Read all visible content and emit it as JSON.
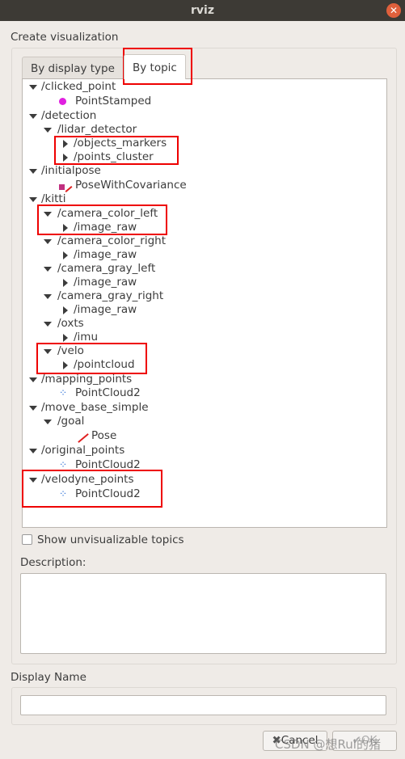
{
  "window": {
    "title": "rviz"
  },
  "heading": "Create visualization",
  "tabs": [
    {
      "label": "By display type",
      "active": false
    },
    {
      "label": "By topic",
      "active": true
    }
  ],
  "tree": [
    {
      "level": 0,
      "kind": "topic",
      "label": "/clicked_point",
      "expanded": true
    },
    {
      "level": 1,
      "kind": "type",
      "label": "PointStamped",
      "icon": "point-stamped-icon"
    },
    {
      "level": 0,
      "kind": "topic",
      "label": "/detection",
      "expanded": true
    },
    {
      "level": 1,
      "kind": "topic",
      "label": "/lidar_detector",
      "expanded": true
    },
    {
      "level": 2,
      "kind": "topic",
      "label": "/objects_markers",
      "expanded": false
    },
    {
      "level": 2,
      "kind": "topic",
      "label": "/points_cluster",
      "expanded": false
    },
    {
      "level": 0,
      "kind": "topic",
      "label": "/initialpose",
      "expanded": true
    },
    {
      "level": 1,
      "kind": "type",
      "label": "PoseWithCovariance",
      "icon": "pose-with-covariance-icon"
    },
    {
      "level": 0,
      "kind": "topic",
      "label": "/kitti",
      "expanded": true
    },
    {
      "level": 1,
      "kind": "topic",
      "label": "/camera_color_left",
      "expanded": true
    },
    {
      "level": 2,
      "kind": "topic",
      "label": "/image_raw",
      "expanded": false
    },
    {
      "level": 1,
      "kind": "topic",
      "label": "/camera_color_right",
      "expanded": true
    },
    {
      "level": 2,
      "kind": "topic",
      "label": "/image_raw",
      "expanded": false
    },
    {
      "level": 1,
      "kind": "topic",
      "label": "/camera_gray_left",
      "expanded": true
    },
    {
      "level": 2,
      "kind": "topic",
      "label": "/image_raw",
      "expanded": false
    },
    {
      "level": 1,
      "kind": "topic",
      "label": "/camera_gray_right",
      "expanded": true
    },
    {
      "level": 2,
      "kind": "topic",
      "label": "/image_raw",
      "expanded": false
    },
    {
      "level": 1,
      "kind": "topic",
      "label": "/oxts",
      "expanded": true
    },
    {
      "level": 2,
      "kind": "topic",
      "label": "/imu",
      "expanded": false
    },
    {
      "level": 1,
      "kind": "topic",
      "label": "/velo",
      "expanded": true
    },
    {
      "level": 2,
      "kind": "topic",
      "label": "/pointcloud",
      "expanded": false
    },
    {
      "level": 0,
      "kind": "topic",
      "label": "/mapping_points",
      "expanded": true
    },
    {
      "level": 1,
      "kind": "type",
      "label": "PointCloud2",
      "icon": "pointcloud-icon"
    },
    {
      "level": 0,
      "kind": "topic",
      "label": "/move_base_simple",
      "expanded": true
    },
    {
      "level": 1,
      "kind": "topic",
      "label": "/goal",
      "expanded": true
    },
    {
      "level": 2,
      "kind": "type",
      "label": "Pose",
      "icon": "pose-icon"
    },
    {
      "level": 0,
      "kind": "topic",
      "label": "/original_points",
      "expanded": true
    },
    {
      "level": 1,
      "kind": "type",
      "label": "PointCloud2",
      "icon": "pointcloud-icon"
    },
    {
      "level": 0,
      "kind": "topic",
      "label": "/velodyne_points",
      "expanded": true
    },
    {
      "level": 1,
      "kind": "type",
      "label": "PointCloud2",
      "icon": "pointcloud-icon"
    }
  ],
  "show_unvisualizable": {
    "label": "Show unvisualizable topics",
    "checked": false
  },
  "description": {
    "label": "Description:",
    "value": ""
  },
  "display_name": {
    "label": "Display Name",
    "value": ""
  },
  "buttons": {
    "cancel": "Cancel",
    "ok": "OK"
  },
  "watermark": "CSDN @想Rui的猪",
  "colors": {
    "highlight": "#e00000",
    "titlebar": "#3d3a35",
    "point_stamped": "#e020e0",
    "pointcloud": "#2a6fd6"
  }
}
